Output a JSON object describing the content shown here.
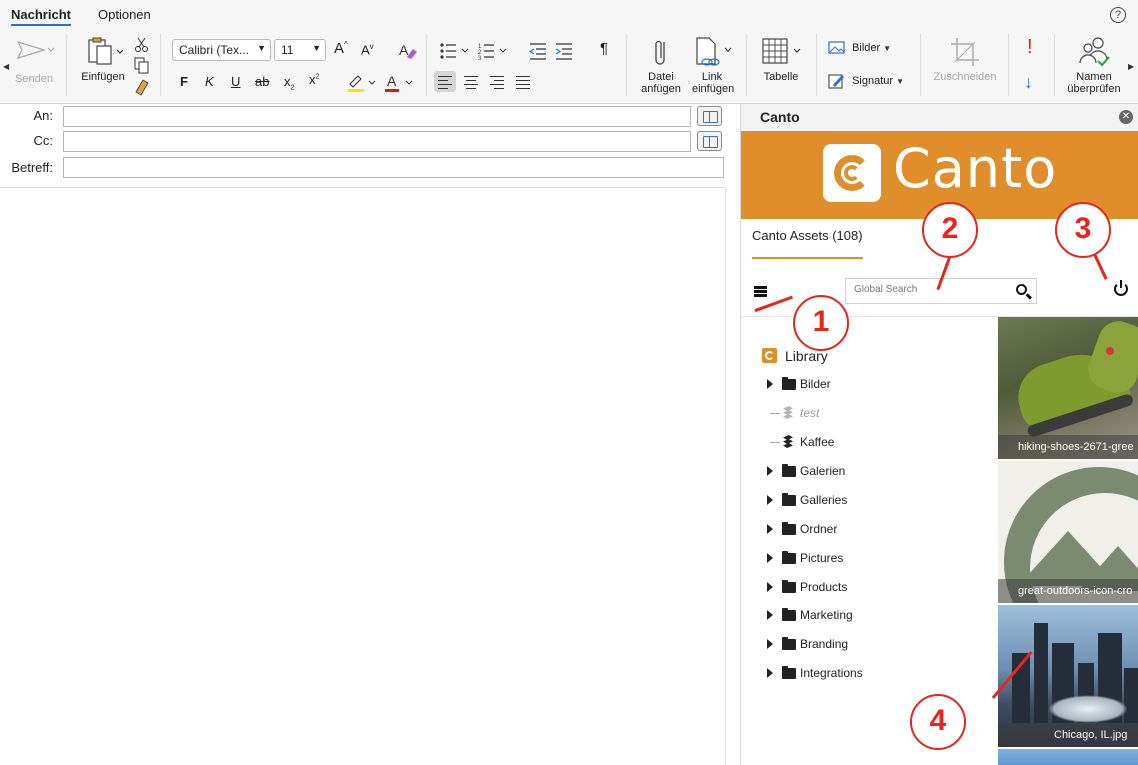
{
  "ribbon_tabs": [
    "Nachricht",
    "Optionen"
  ],
  "toolbar": {
    "send": "Senden",
    "paste": "Einfügen",
    "font_name": "Calibri (Tex...",
    "font_size": "11",
    "bold": "F",
    "italic": "K",
    "underline": "U",
    "strike": "ab",
    "subscript": "x",
    "superscript": "x",
    "grow": "A",
    "shrink": "A",
    "pilcrow": "¶",
    "attach": "Datei anfügen",
    "link": "Link einfügen",
    "table": "Tabelle",
    "images": "Bilder",
    "signature": "Signatur",
    "crop": "Zuschneiden",
    "check_names": "Namen überprüfen",
    "importance_high": "!",
    "importance_low": "↓"
  },
  "fields": {
    "to_label": "An:",
    "cc_label": "Cc:",
    "subject_label": "Betreff:"
  },
  "canto": {
    "pane_title": "Canto",
    "logo_text": "Canto",
    "assets_tab": "Canto Assets (108)",
    "search_placeholder": "Global Search",
    "library_label": "Library",
    "tree": [
      {
        "label": "Bilder",
        "kind": "folder"
      },
      {
        "label": "test",
        "kind": "album-muted"
      },
      {
        "label": "Kaffee",
        "kind": "album"
      },
      {
        "label": "Galerien",
        "kind": "folder"
      },
      {
        "label": "Galleries",
        "kind": "folder"
      },
      {
        "label": "Ordner",
        "kind": "folder"
      },
      {
        "label": "Pictures",
        "kind": "folder"
      },
      {
        "label": "Products",
        "kind": "folder"
      },
      {
        "label": "Marketing",
        "kind": "folder"
      },
      {
        "label": "Branding",
        "kind": "folder"
      },
      {
        "label": "Integrations",
        "kind": "folder"
      }
    ],
    "thumbnails": [
      {
        "caption": "hiking-shoes-2671-gree"
      },
      {
        "caption": "great-outdoors-icon-cro"
      },
      {
        "caption": "Chicago, IL.jpg"
      }
    ]
  },
  "callouts": [
    "1",
    "2",
    "3",
    "4"
  ],
  "colors": {
    "canto_orange": "#e08e2c",
    "callout_red": "#e8251b",
    "accent_blue": "#2b6fd6"
  }
}
